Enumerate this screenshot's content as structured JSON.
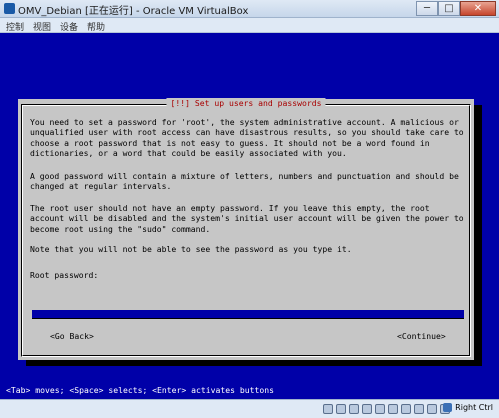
{
  "window": {
    "title": "OMV_Debian [正在运行] - Oracle VM VirtualBox",
    "minimize": "─",
    "maximize": "□",
    "close": "✕"
  },
  "menu": {
    "items": [
      "控制",
      "视图",
      "设备",
      "帮助"
    ]
  },
  "dialog": {
    "title": "[!!] Set up users and passwords",
    "paragraphs": [
      "You need to set a password for 'root', the system administrative account. A malicious or\nunqualified user with root access can have disastrous results, so you should take care to\nchoose a root password that is not easy to guess. It should not be a word found in\ndictionaries, or a word that could be easily associated with you.",
      "A good password will contain a mixture of letters, numbers and punctuation and should be\nchanged at regular intervals.",
      "The root user should not have an empty password. If you leave this empty, the root\naccount will be disabled and the system's initial user account will be given the power to\nbecome root using the \"sudo\" command.",
      "Note that you will not be able to see the password as you type it."
    ],
    "field_label": "Root password:",
    "password_value": "",
    "back_button": "<Go Back>",
    "continue_button": "<Continue>"
  },
  "help_line": "<Tab> moves; <Space> selects; <Enter> activates buttons",
  "statusbar": {
    "icons": [
      "hard-disk-icon",
      "optical-drive-icon",
      "audio-icon",
      "network-icon",
      "usb-icon",
      "shared-folder-icon",
      "display-icon",
      "video-capture-icon",
      "cpu-icon",
      "mouse-integration-icon"
    ],
    "host_key": "Right Ctrl"
  },
  "colors": {
    "console_bg": "#0000a8",
    "dialog_bg": "#c6c6c6",
    "title_red": "#a80000"
  }
}
